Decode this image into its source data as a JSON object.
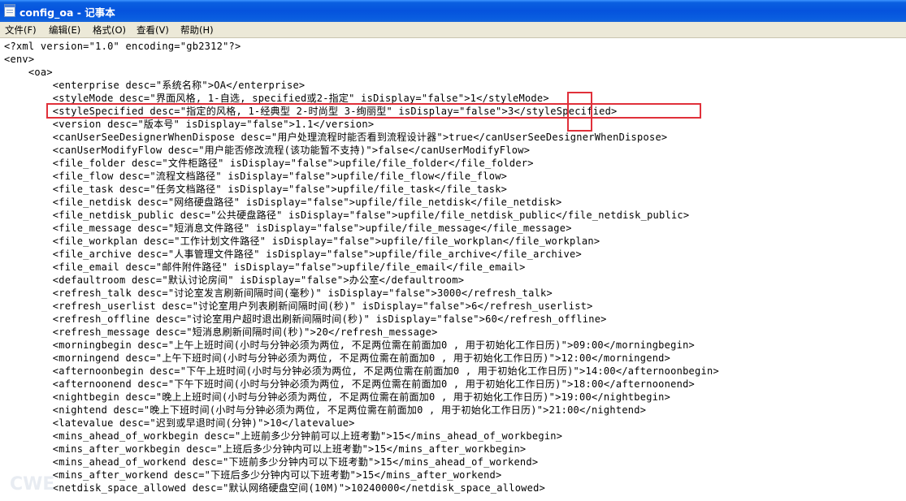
{
  "window": {
    "title": "config_oa - 记事本"
  },
  "menu": [
    {
      "label": "文件(F)"
    },
    {
      "label": "编辑(E)"
    },
    {
      "label": "格式(O)"
    },
    {
      "label": "查看(V)"
    },
    {
      "label": "帮助(H)"
    }
  ],
  "editor": {
    "lines": [
      "<?xml version=\"1.0\" encoding=\"gb2312\"?>",
      "<env>",
      "    <oa>",
      "        <enterprise desc=\"系统名称\">OA</enterprise>",
      "        <styleMode desc=\"界面风格, 1-自选, specified或2-指定\" isDisplay=\"false\">1</styleMode>",
      "        <styleSpecified desc=\"指定的风格, 1-经典型 2-时尚型 3-绚丽型\" isDisplay=\"false\">3</styleSpecified>",
      "        <version desc=\"版本号\" isDisplay=\"false\">1.1</version>",
      "        <canUserSeeDesignerWhenDispose desc=\"用户处理流程时能否看到流程设计器\">true</canUserSeeDesignerWhenDispose>",
      "        <canUserModifyFlow desc=\"用户能否修改流程(该功能暂不支持)\">false</canUserModifyFlow>",
      "        <file_folder desc=\"文件柜路径\" isDisplay=\"false\">upfile/file_folder</file_folder>",
      "        <file_flow desc=\"流程文档路径\" isDisplay=\"false\">upfile/file_flow</file_flow>",
      "        <file_task desc=\"任务文档路径\" isDisplay=\"false\">upfile/file_task</file_task>",
      "        <file_netdisk desc=\"网络硬盘路径\" isDisplay=\"false\">upfile/file_netdisk</file_netdisk>",
      "        <file_netdisk_public desc=\"公共硬盘路径\" isDisplay=\"false\">upfile/file_netdisk_public</file_netdisk_public>",
      "        <file_message desc=\"短消息文件路径\" isDisplay=\"false\">upfile/file_message</file_message>",
      "        <file_workplan desc=\"工作计划文件路径\" isDisplay=\"false\">upfile/file_workplan</file_workplan>",
      "        <file_archive desc=\"人事管理文件路径\" isDisplay=\"false\">upfile/file_archive</file_archive>",
      "        <file_email desc=\"邮件附件路径\" isDisplay=\"false\">upfile/file_email</file_email>",
      "        <defaultroom desc=\"默认讨论房间\" isDisplay=\"false\">办公室</defaultroom>",
      "        <refresh_talk desc=\"讨论室发言刷新间隔时间(毫秒)\" isDisplay=\"false\">3000</refresh_talk>",
      "        <refresh_userlist desc=\"讨论室用户列表刷新间隔时间(秒)\" isDisplay=\"false\">6</refresh_userlist>",
      "        <refresh_offline desc=\"讨论室用户超时退出刷新间隔时间(秒)\" isDisplay=\"false\">60</refresh_offline>",
      "        <refresh_message desc=\"短消息刷新间隔时间(秒)\">20</refresh_message>",
      "        <morningbegin desc=\"上午上班时间(小时与分钟必须为两位, 不足两位需在前面加0 , 用于初始化工作日历)\">09:00</morningbegin>",
      "        <morningend desc=\"上午下班时间(小时与分钟必须为两位, 不足两位需在前面加0 , 用于初始化工作日历)\">12:00</morningend>",
      "        <afternoonbegin desc=\"下午上班时间(小时与分钟必须为两位, 不足两位需在前面加0 , 用于初始化工作日历)\">14:00</afternoonbegin>",
      "        <afternoonend desc=\"下午下班时间(小时与分钟必须为两位, 不足两位需在前面加0 , 用于初始化工作日历)\">18:00</afternoonend>",
      "        <nightbegin desc=\"晚上上班时间(小时与分钟必须为两位, 不足两位需在前面加0 , 用于初始化工作日历)\">19:00</nightbegin>",
      "        <nightend desc=\"晚上下班时间(小时与分钟必须为两位, 不足两位需在前面加0 , 用于初始化工作日历)\">21:00</nightend>",
      "        <latevalue desc=\"迟到或早退时间(分钟)\">10</latevalue>",
      "        <mins_ahead_of_workbegin desc=\"上班前多少分钟前可以上班考勤\">15</mins_ahead_of_workbegin>",
      "        <mins_after_workbegin desc=\"上班后多少分钟内可以上班考勤\">15</mins_after_workbegin>",
      "        <mins_ahead_of_workend desc=\"下班前多少分钟内可以下班考勤\">15</mins_ahead_of_workend>",
      "        <mins_after_workend desc=\"下班后多少分钟内可以下班考勤\">15</mins_after_workend>",
      "        <netdisk_space_allowed desc=\"默认网络硬盘空间(10M)\">10240000</netdisk_space_allowed>"
    ]
  },
  "colors": {
    "highlight": "#e0303a",
    "titlebar": "#0553dd",
    "menubar": "#ece9d8"
  },
  "watermark": "CWE"
}
